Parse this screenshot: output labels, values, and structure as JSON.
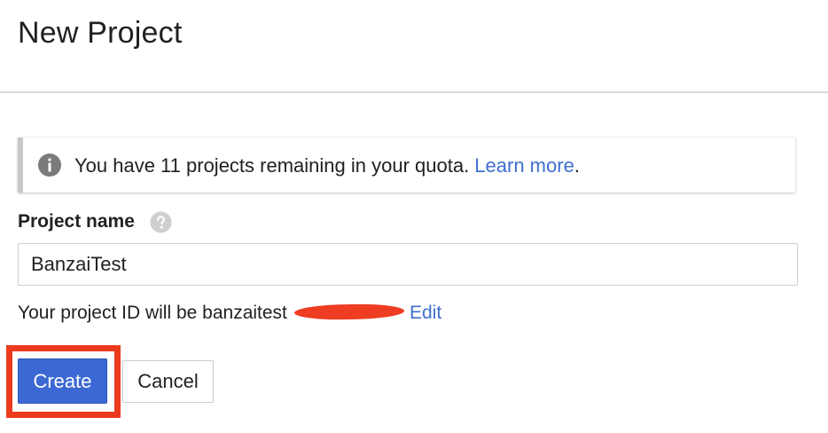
{
  "header": {
    "title": "New Project"
  },
  "notice": {
    "icon": "info-icon",
    "text_prefix": "You have 11 projects remaining in your quota. ",
    "link_label": "Learn more",
    "text_suffix": "."
  },
  "form": {
    "project_name_label": "Project name",
    "help_icon": "help-circle-icon",
    "project_name_value": "BanzaiTest",
    "project_id_text": "Your project ID will be banzaitest",
    "edit_label": "Edit"
  },
  "actions": {
    "create_label": "Create",
    "cancel_label": "Cancel"
  },
  "colors": {
    "accent": "#3b68d3",
    "link": "#3f6fce",
    "highlight": "#ec3a1f",
    "redaction": "#ee3d23"
  }
}
